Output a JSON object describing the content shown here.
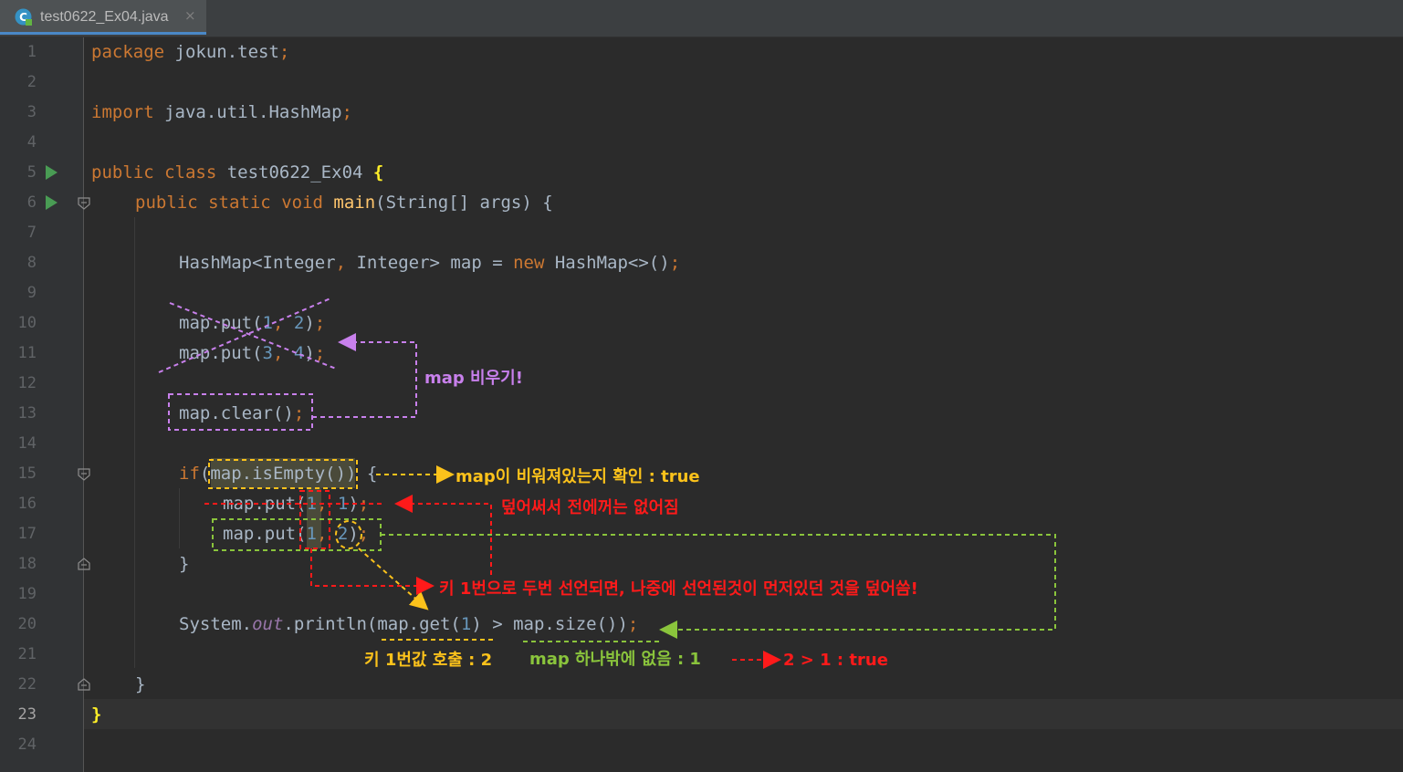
{
  "tab": {
    "title": "test0622_Ex04.java",
    "close": "×"
  },
  "gutter": {
    "line_numbers": [
      "1",
      "2",
      "3",
      "4",
      "5",
      "6",
      "7",
      "8",
      "9",
      "10",
      "11",
      "12",
      "13",
      "14",
      "15",
      "16",
      "17",
      "18",
      "19",
      "20",
      "21",
      "22",
      "23",
      "24"
    ],
    "current_line": "23"
  },
  "code": {
    "l1": {
      "kw": "package",
      "rest": " jokun.test",
      "semi": ";"
    },
    "l3": {
      "kw": "import",
      "rest": " java.util.HashMap",
      "semi": ";"
    },
    "l5": {
      "kw1": "public",
      "kw2": "class",
      "name": " test0622_Ex04 ",
      "brace": "{"
    },
    "l6": {
      "kw1": "public",
      "kw2": "static",
      "kw3": "void",
      "fn": "main",
      "rest": "(String[] args) {"
    },
    "l8": {
      "a": "HashMap<Integer",
      "comma": ",",
      "b": " Integer> map = ",
      "kw": "new",
      "c": " HashMap<>()",
      "semi": ";"
    },
    "l10": {
      "a": "map.put(",
      "n1": "1",
      "comma": ",",
      "n2": "2",
      "b": ")",
      "semi": ";"
    },
    "l11": {
      "a": "map.put(",
      "n1": "3",
      "comma": ",",
      "n2": "4",
      "b": ")",
      "semi": ";"
    },
    "l13": {
      "a": "map.clear()",
      "semi": ";"
    },
    "l15": {
      "kw": "if",
      "rest": "(map.isEmpty()) {"
    },
    "l16": {
      "a": "map.put(",
      "n1": "1",
      "comma": ",",
      "n2": "1",
      "b": ")",
      "semi": ";"
    },
    "l17": {
      "a": "map.put(",
      "n1": "1",
      "comma": ",",
      "n2": "2",
      "b": ")",
      "semi": ";"
    },
    "l18": {
      "text": "}"
    },
    "l20": {
      "a": "System.",
      "field": "out",
      "b": ".println(map.get(",
      "n1": "1",
      "c": ") > map.size())",
      "semi": ";"
    },
    "l22": {
      "text": "}"
    },
    "l23": {
      "text": "}"
    }
  },
  "annotations": {
    "clear_note": "map 비우기!",
    "isempty_note": "map이 비워져있는지 확인 : true",
    "overwrite_note": "덮어써서 전에꺼는 없어짐",
    "key_note": "키 1번으로 두번 선언되면, 나중에 선언된것이 먼저있던 것을 덮어씀!",
    "get_note": "키 1번값 호출 : 2",
    "size_note": "map 하나밖에 없음 : 1",
    "result_note": "2 > 1 : true"
  },
  "colors": {
    "purple": "#c880ec",
    "yellow": "#fcc21b",
    "red": "#ff1a1a",
    "green": "#8ac43c",
    "keyword": "#cc7832",
    "number": "#6897bb",
    "function": "#ffc66d"
  },
  "icons": {
    "file": "java-class-icon",
    "run": "run-icon",
    "fold": "fold-icon"
  }
}
